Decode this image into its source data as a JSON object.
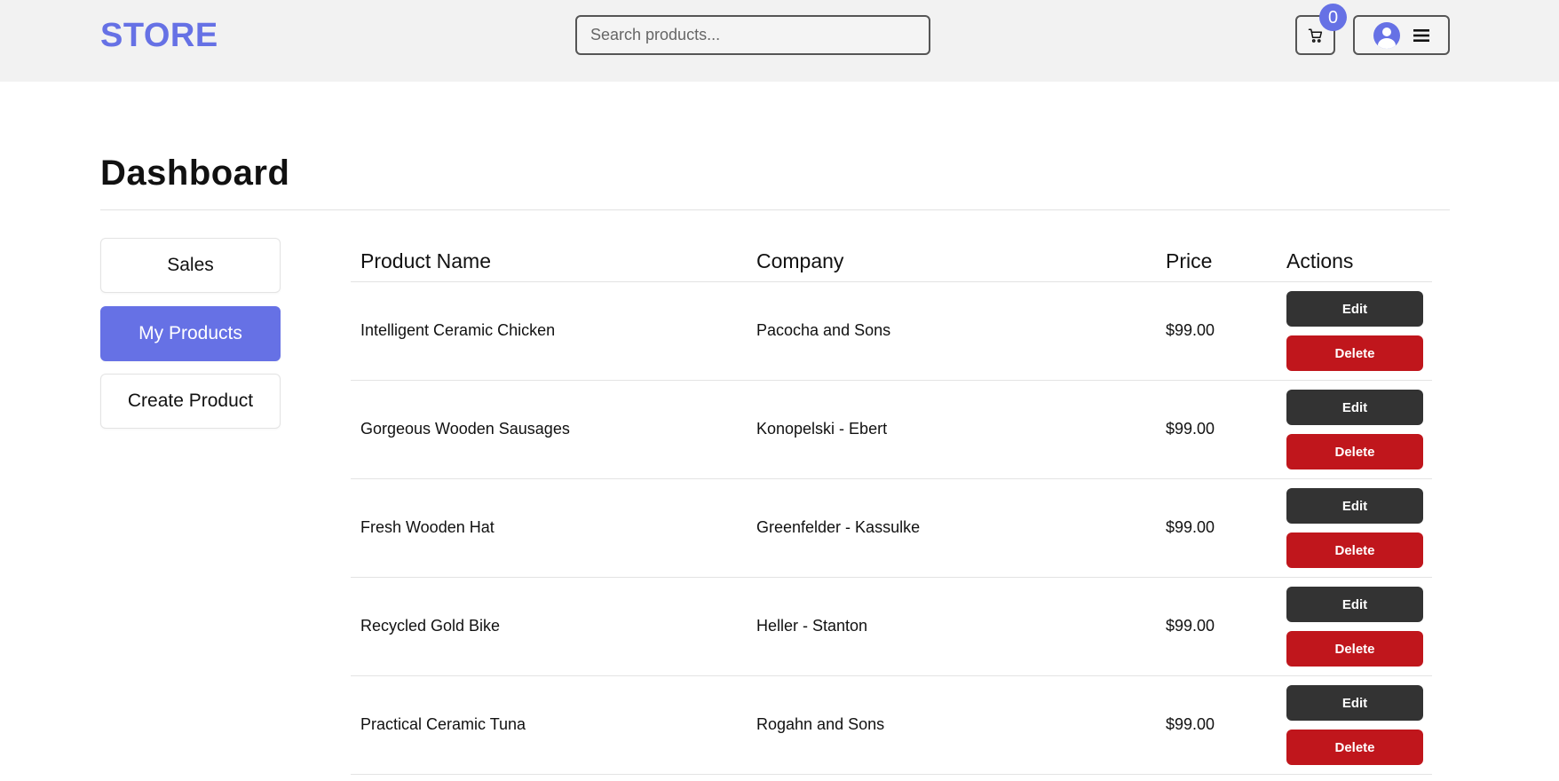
{
  "header": {
    "logo": "STORE",
    "search_placeholder": "Search products...",
    "cart_count": "0",
    "cart_icon": "cart-icon",
    "user_icon": "user-avatar-icon",
    "menu_icon": "hamburger-menu-icon"
  },
  "page": {
    "title": "Dashboard"
  },
  "sidebar": {
    "items": [
      {
        "label": "Sales",
        "active": false
      },
      {
        "label": "My Products",
        "active": true
      },
      {
        "label": "Create Product",
        "active": false
      }
    ]
  },
  "table": {
    "headers": [
      "Product Name",
      "Company",
      "Price",
      "Actions"
    ],
    "edit_label": "Edit",
    "delete_label": "Delete",
    "rows": [
      {
        "name": "Intelligent Ceramic Chicken",
        "company": "Pacocha and Sons",
        "price": "$99.00"
      },
      {
        "name": "Gorgeous Wooden Sausages",
        "company": "Konopelski - Ebert",
        "price": "$99.00"
      },
      {
        "name": "Fresh Wooden Hat",
        "company": "Greenfelder - Kassulke",
        "price": "$99.00"
      },
      {
        "name": "Recycled Gold Bike",
        "company": "Heller - Stanton",
        "price": "$99.00"
      },
      {
        "name": "Practical Ceramic Tuna",
        "company": "Rogahn and Sons",
        "price": "$99.00"
      }
    ]
  },
  "colors": {
    "accent": "#6671e5",
    "edit": "#333333",
    "delete": "#c0161c",
    "header_bg": "#f2f2f2"
  }
}
